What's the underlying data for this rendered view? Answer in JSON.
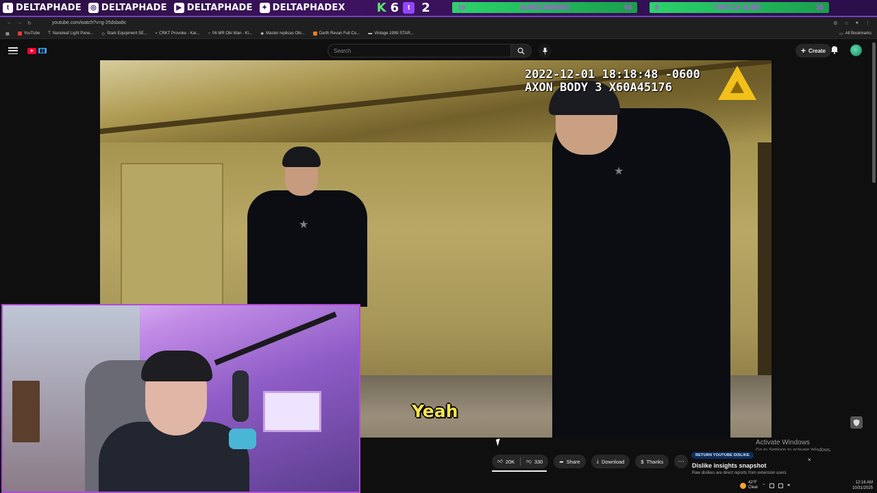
{
  "stream_overlay": {
    "handles": [
      {
        "platform_icon": "twitch-icon",
        "glyph": "t",
        "name": "DELTAPHADE"
      },
      {
        "platform_icon": "instagram-icon",
        "glyph": "◎",
        "name": "DELTAPHADE"
      },
      {
        "platform_icon": "youtube-icon",
        "glyph": "▶",
        "name": "DELTAPHADE"
      },
      {
        "platform_icon": "twitter-icon",
        "glyph": "✦",
        "name": "DELTAPHADEX"
      }
    ],
    "kick_value": "6",
    "twitch_value": "2",
    "subscribers": {
      "current": "19",
      "label": "SUBSCRIBERS",
      "goal": "40"
    },
    "twitch_subs": {
      "current": "8",
      "label": "TWITCH SUBS",
      "goal": "20"
    }
  },
  "browser": {
    "url": "youtube.com/watch?v=g-25dsba8c",
    "bookmarks": [
      "YouTube",
      "Nanoleaf Light Pane...",
      "Stark Equipment SE...",
      "CRKT Provoke - Kar...",
      "06 MR Obi Wan - Ki...",
      "Master replicas Obi...",
      "Darth Revan Full Co...",
      "Vintage 1999 STAR..."
    ],
    "all_bookmarks": "All Bookmarks"
  },
  "youtube": {
    "search_placeholder": "Search",
    "create_label": "Create"
  },
  "video": {
    "timestamp_line1": "2022-12-01 18:18:48 -0600",
    "timestamp_line2": "AXON BODY 3 X60A45176",
    "caption": "Yeah"
  },
  "actions": {
    "likes": "20K",
    "dislikes": "330",
    "share": "Share",
    "download": "Download",
    "thanks": "Thanks"
  },
  "windows_activation": {
    "title": "Activate Windows",
    "subtitle": "Go to Settings to activate Windows."
  },
  "ryd_popup": {
    "tag": "RETURN YOUTUBE DISLIKE",
    "title": "Dislike insights snapshot",
    "text": "Raw dislikes are direct reports from extension users",
    "close": "×"
  },
  "tray": {
    "temperature": "42°F",
    "weather": "Clear",
    "time": "12:16 AM",
    "date": "10/31/2025"
  },
  "colors": {
    "overlay_bg": "#3d1260",
    "overlay_accent": "#7a3dc8",
    "goal_bar": "#2bd36a",
    "caption": "#f5e44b",
    "youtube_red": "#ff0033",
    "webcam_border": "#b24bd8"
  }
}
